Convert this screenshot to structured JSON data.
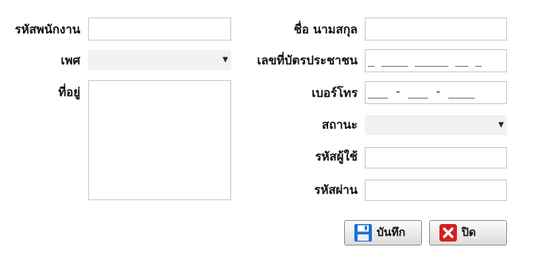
{
  "form": {
    "employee_id": {
      "label": "รหัสพนักงาน",
      "value": ""
    },
    "gender": {
      "label": "เพศ",
      "value": ""
    },
    "address": {
      "label": "ที่อยู่",
      "value": ""
    },
    "full_name": {
      "label": "ชื่อ นามสกุล",
      "value": ""
    },
    "id_card": {
      "label": "เลขที่บัตรประชาชน",
      "mask": "_ ____ _____ __ _"
    },
    "phone": {
      "label": "เบอร์โทร",
      "mask": "___ - ___ - ____"
    },
    "status": {
      "label": "สถานะ",
      "value": ""
    },
    "username": {
      "label": "รหัสผู้ใช้",
      "value": ""
    },
    "password": {
      "label": "รหัสผ่าน",
      "value": ""
    }
  },
  "buttons": {
    "save": {
      "label": "บันทึก",
      "icon": "floppy-disk-icon",
      "color": "#1e6fd0"
    },
    "close": {
      "label": "ปิด",
      "icon": "close-icon",
      "color": "#d32020"
    }
  }
}
